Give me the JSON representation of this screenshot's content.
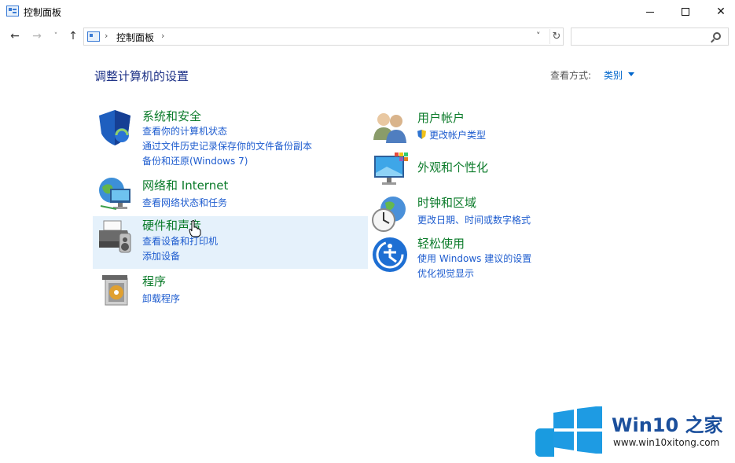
{
  "window": {
    "title": "控制面板",
    "controls": {
      "minimize": "minimize",
      "maximize": "maximize",
      "close": "✕"
    }
  },
  "nav": {
    "back": "←",
    "forward": "→",
    "recent": "˅",
    "up": "↑",
    "breadcrumb": "控制面板",
    "separator": "›",
    "dropdown": "˅",
    "refresh": "↻",
    "search_placeholder": ""
  },
  "content": {
    "heading": "调整计算机的设置",
    "view_by_label": "查看方式:",
    "view_by_value": "类别"
  },
  "categories": [
    {
      "title": "系统和安全",
      "links": [
        "查看你的计算机状态",
        "通过文件历史记录保存你的文件备份副本",
        "备份和还原(Windows 7)"
      ]
    },
    {
      "title": "网络和 Internet",
      "links": [
        "查看网络状态和任务"
      ]
    },
    {
      "title": "硬件和声音",
      "links": [
        "查看设备和打印机",
        "添加设备"
      ]
    },
    {
      "title": "程序",
      "links": [
        "卸载程序"
      ]
    },
    {
      "title": "用户帐户",
      "links": [
        "更改帐户类型"
      ]
    },
    {
      "title": "外观和个性化",
      "links": []
    },
    {
      "title": "时钟和区域",
      "links": [
        "更改日期、时间或数字格式"
      ]
    },
    {
      "title": "轻松使用",
      "links": [
        "使用 Windows 建议的设置",
        "优化视觉显示"
      ]
    }
  ],
  "watermark": {
    "brand": "Win10 之家",
    "url": "www.win10xitong.com"
  },
  "icons": {
    "system_security": "shield-icon",
    "network": "network-globe-icon",
    "hardware": "printer-icon",
    "programs": "programs-box-icon",
    "user_accounts": "users-icon",
    "appearance": "monitor-palette-icon",
    "clock_region": "clock-globe-icon",
    "ease_of_access": "ease-of-access-icon"
  }
}
